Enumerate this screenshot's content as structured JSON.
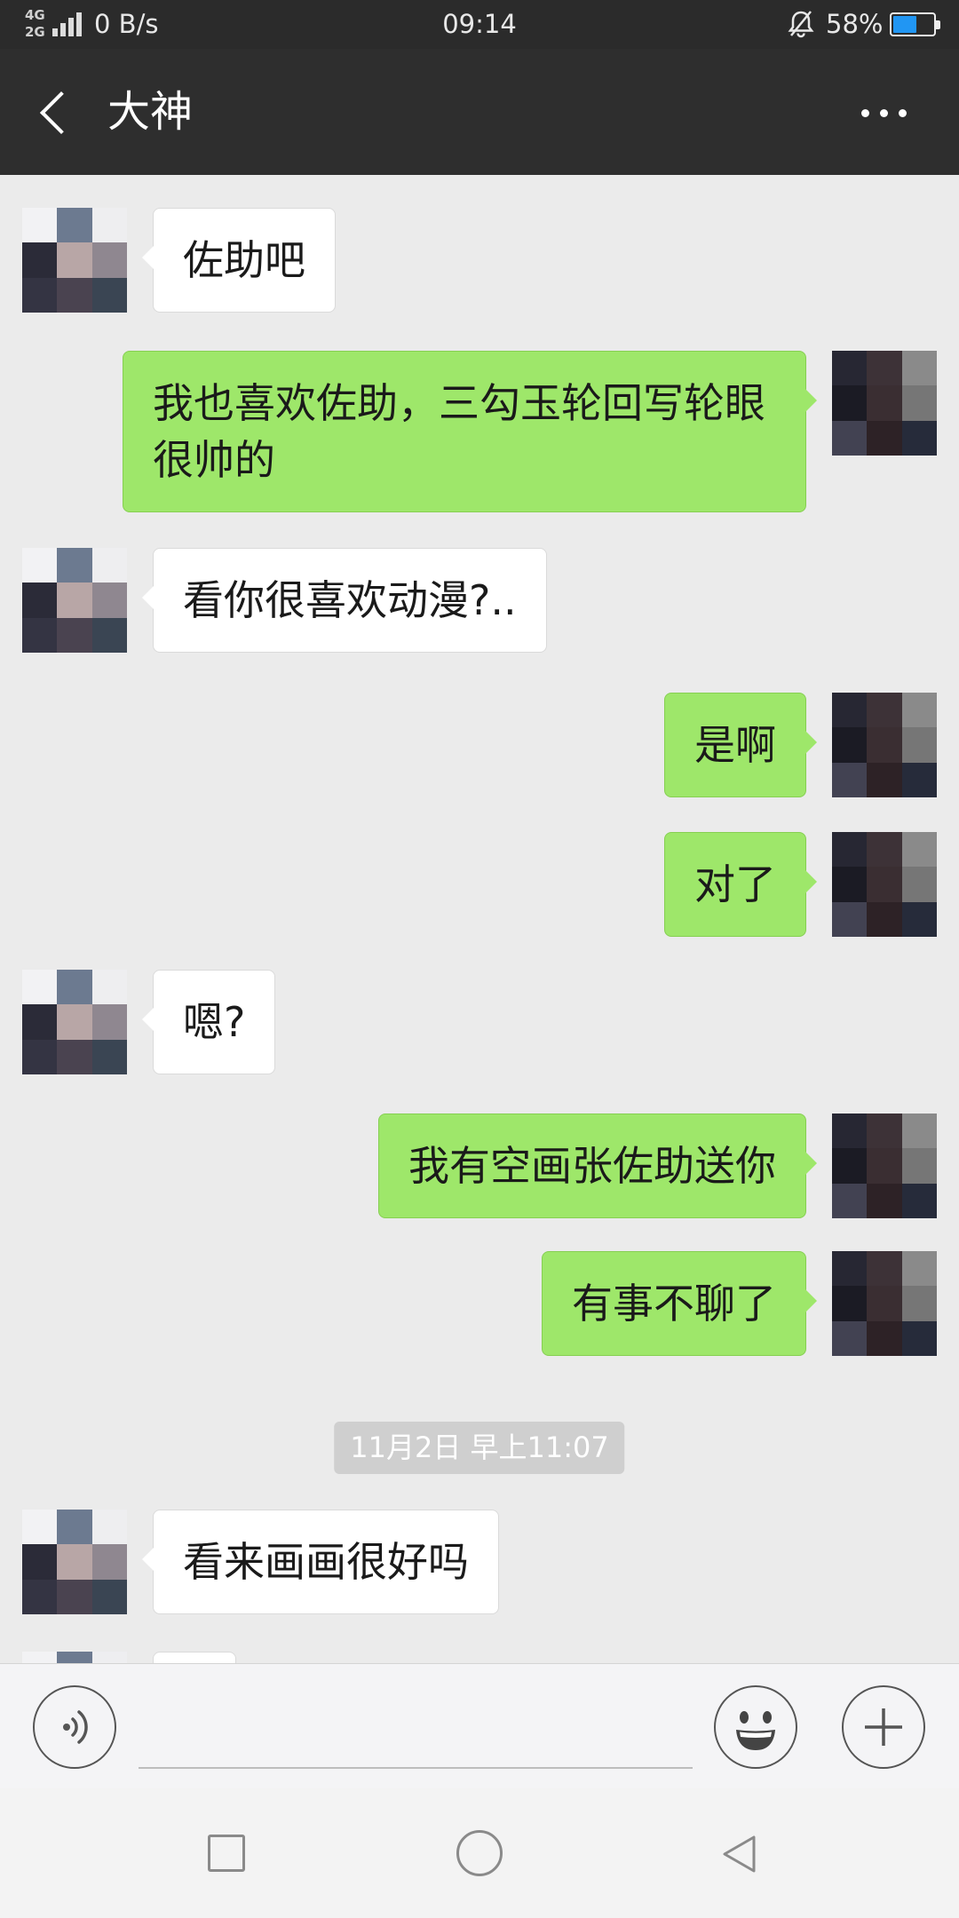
{
  "colors": {
    "header_bg": "#2e2e2e",
    "chat_bg": "#ebebeb",
    "bubble_sent": "#9ee76a",
    "bubble_received": "#ffffff",
    "timestamp_bg": "#cfcfcf"
  },
  "status_bar": {
    "network_top": "4G",
    "network_bottom": "2G",
    "speed": "0 B/s",
    "time": "09:14",
    "battery": "58%",
    "signal_icon": "signal-icon",
    "mute_icon": "bell-off-icon",
    "battery_icon": "battery-icon"
  },
  "header": {
    "title": "大神",
    "back_icon": "chevron-left-icon",
    "more_icon": "more-dots-icon"
  },
  "messages": [
    {
      "sent": false,
      "text": "佐助吧"
    },
    {
      "sent": true,
      "text": "我也喜欢佐助，三勾玉轮回写轮眼很帅的"
    },
    {
      "sent": false,
      "text": "看你很喜欢动漫?.."
    },
    {
      "sent": true,
      "text": "是啊"
    },
    {
      "sent": true,
      "text": "对了"
    },
    {
      "sent": false,
      "text": "嗯?"
    },
    {
      "sent": true,
      "text": "我有空画张佐助送你"
    },
    {
      "sent": true,
      "text": "有事不聊了"
    },
    {
      "sent": false,
      "text": "看来画画很好吗"
    }
  ],
  "timestamp": "11月2日 早上11:07",
  "input_bar": {
    "voice_icon": "voice-icon",
    "emoji_icon": "emoji-icon",
    "plus_icon": "plus-icon"
  },
  "nav_bar": {
    "recents_icon": "square-icon",
    "home_icon": "circle-icon",
    "back_icon": "triangle-back-icon"
  }
}
